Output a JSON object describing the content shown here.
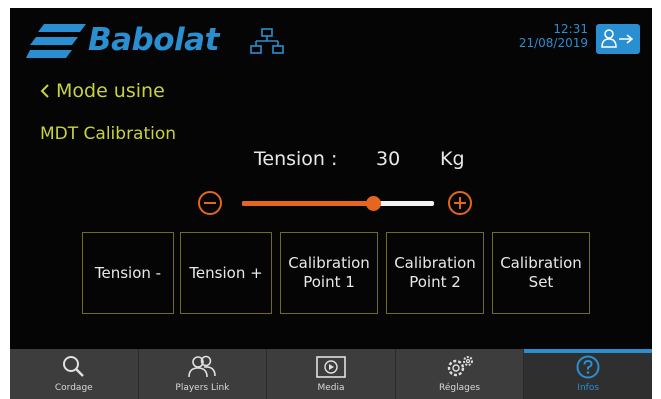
{
  "header": {
    "brand": "Babolat",
    "time": "12:31",
    "date": "21/08/2019",
    "logo_icon": "babolat-stripes-logo",
    "network_icon": "network-icon",
    "logout_icon": "user-logout-icon",
    "accent_color": "#2a8fd1"
  },
  "page": {
    "back_label": "Mode usine",
    "section_title": "MDT Calibration",
    "title_color": "#c9d23b"
  },
  "tension": {
    "label": "Tension :",
    "value": "30",
    "unit": "Kg",
    "slider_level": 0.68,
    "slider_color": "#e4661f"
  },
  "controls": [
    {
      "line1": "Tension -",
      "line2": ""
    },
    {
      "line1": "Tension +",
      "line2": ""
    },
    {
      "line1": "Calibration",
      "line2": "Point 1"
    },
    {
      "line1": "Calibration",
      "line2": "Point 2"
    },
    {
      "line1": "Calibration",
      "line2": "Set"
    }
  ],
  "nav": {
    "tabs": [
      {
        "label": "Cordage",
        "icon": "magnifier-icon",
        "active": false
      },
      {
        "label": "Players Link",
        "icon": "players-icon",
        "active": false
      },
      {
        "label": "Media",
        "icon": "play-icon",
        "active": false
      },
      {
        "label": "Réglages",
        "icon": "gears-icon",
        "active": false
      },
      {
        "label": "Infos",
        "icon": "help-icon",
        "active": true
      }
    ]
  }
}
